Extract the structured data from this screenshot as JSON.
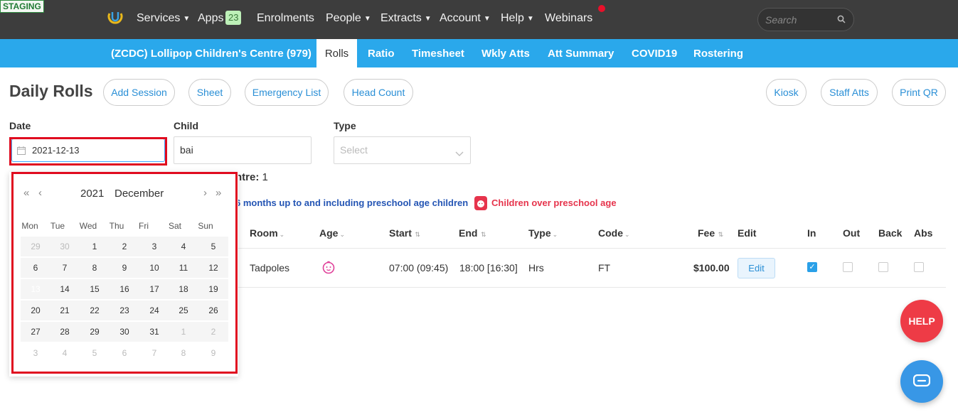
{
  "staging_label": "STAGING",
  "nav": {
    "items": [
      "Services",
      "Apps",
      "Enrolments",
      "People",
      "Extracts",
      "Account",
      "Help",
      "Webinars"
    ],
    "apps_badge": "23",
    "search_placeholder": "Search"
  },
  "subnav": {
    "centre": "(ZCDC) Lollipop Children's Centre (979)",
    "tabs": [
      "Rolls",
      "Ratio",
      "Timesheet",
      "Wkly Atts",
      "Att Summary",
      "COVID19",
      "Rostering"
    ],
    "active_tab": "Rolls"
  },
  "page": {
    "title": "Daily Rolls",
    "left_buttons": [
      "Add Session",
      "Sheet",
      "Emergency List",
      "Head Count"
    ],
    "right_buttons": [
      "Kiosk",
      "Staff Atts",
      "Print QR"
    ]
  },
  "filters": {
    "date_label": "Date",
    "date_value": "2021-12-13",
    "child_label": "Child",
    "child_value": "bai",
    "type_label": "Type",
    "type_placeholder": "Select"
  },
  "summary": {
    "centre_count_label": "ntre:",
    "centre_count_value": "1",
    "legend_blue": "6 months up to and including preschool age children",
    "legend_red": "Children over preschool age"
  },
  "table": {
    "headers": [
      "Room",
      "Age",
      "Start",
      "End",
      "Type",
      "Code",
      "Fee",
      "Edit",
      "In",
      "Out",
      "Back",
      "Abs"
    ],
    "rows": [
      {
        "room": "Tadpoles",
        "start": "07:00 (09:45)",
        "end": "18:00 [16:30]",
        "type": "Hrs",
        "code": "FT",
        "fee": "$100.00",
        "edit": "Edit",
        "in": true,
        "out": false,
        "back": false,
        "abs": false
      }
    ]
  },
  "calendar": {
    "year": "2021",
    "month": "December",
    "weekdays": [
      "Mon",
      "Tue",
      "Wed",
      "Thu",
      "Fri",
      "Sat",
      "Sun"
    ],
    "weeks": [
      [
        "29",
        "30",
        "1",
        "2",
        "3",
        "4",
        "5"
      ],
      [
        "6",
        "7",
        "8",
        "9",
        "10",
        "11",
        "12"
      ],
      [
        "13",
        "14",
        "15",
        "16",
        "17",
        "18",
        "19"
      ],
      [
        "20",
        "21",
        "22",
        "23",
        "24",
        "25",
        "26"
      ],
      [
        "27",
        "28",
        "29",
        "30",
        "31",
        "1",
        "2"
      ],
      [
        "3",
        "4",
        "5",
        "6",
        "7",
        "8",
        "9"
      ]
    ],
    "selected": "13",
    "nav": {
      "prev_year": "«",
      "prev_month": "‹",
      "next_month": "›",
      "next_year": "»"
    }
  },
  "floating": {
    "help_label": "HELP"
  },
  "colors": {
    "topbar": "#3d3d3d",
    "subbar": "#2aa8eb",
    "highlight": "#e00b1f",
    "link": "#2a8fd6"
  }
}
